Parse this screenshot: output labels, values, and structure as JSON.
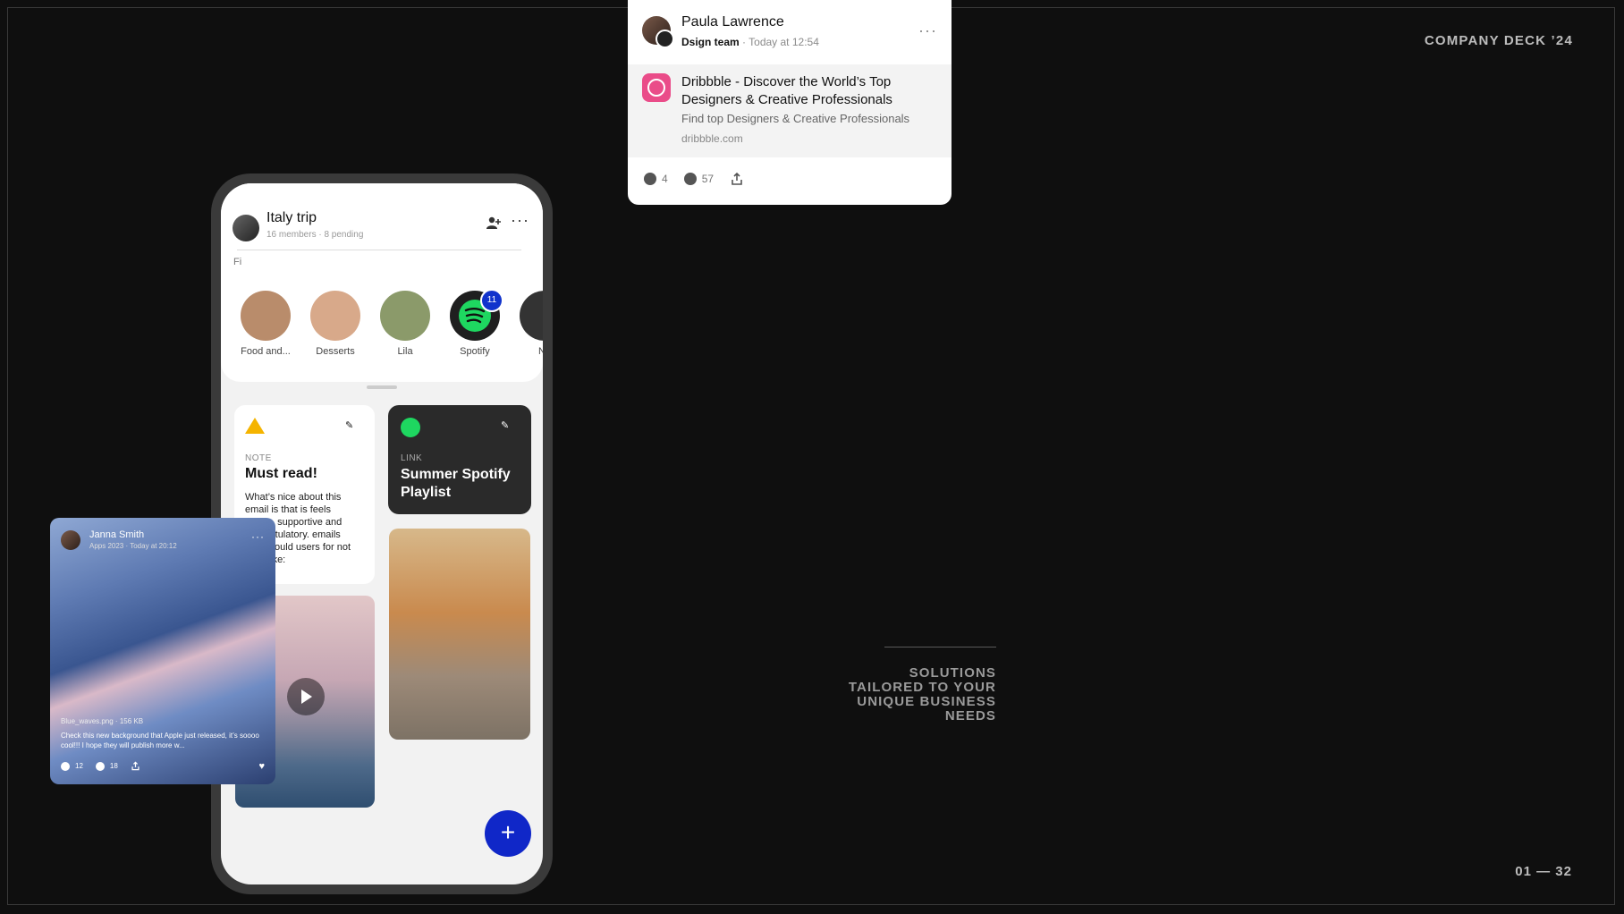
{
  "deck": {
    "title": "COMPANY DECK ’24",
    "page": "01  — 32"
  },
  "tagline": [
    "SOLUTIONS",
    "TAILORED TO YOUR",
    "UNIQUE  BUSINESS",
    "NEEDS"
  ],
  "post_card": {
    "author": "Paula Lawrence",
    "team": "Dsign team",
    "time": "· Today at 12:54",
    "more": "···",
    "link_title": "Dribbble - Discover the World’s Top Designers & Creative Professionals",
    "link_desc": "Find top Designers & Creative Professionals",
    "link_url": "dribbble.com",
    "comments": "4",
    "tags": "57",
    "icons": {
      "comment": "comment-icon",
      "tag": "tag-icon",
      "share": "share-icon"
    }
  },
  "phone": {
    "group_title": "Italy trip",
    "group_sub": "16 members · 8 pending",
    "more": "···",
    "ghost_letter": "Fi",
    "stories": [
      {
        "label": "Food and...",
        "color": "#b98c6b"
      },
      {
        "label": "Desserts",
        "color": "#d8a98a"
      },
      {
        "label": "Lila",
        "color": "#8b9a6a"
      },
      {
        "label": "Spotify",
        "color": "#1f1f1f",
        "badge": "11"
      },
      {
        "label": "Ne",
        "color": "#333333"
      }
    ],
    "note": {
      "tag": "NOTE",
      "title": "Must read!",
      "body": "What’s nice about this email is that is feels gentle, supportive and congratulatory. emails here would users for not lines like:"
    },
    "link": {
      "tag": "LINK",
      "title": "Summer Spotify Playlist"
    },
    "fab": "+"
  },
  "media_card": {
    "author": "Janna Smith",
    "meta": "Apps 2023 · Today at 20:12",
    "more": "···",
    "file": "Blue_waves.png · 156 KB",
    "message": "Check this new background that Apple just released, it’s soooo cool!!! I hope they will publish more w...",
    "comments": "12",
    "tags": "18"
  }
}
